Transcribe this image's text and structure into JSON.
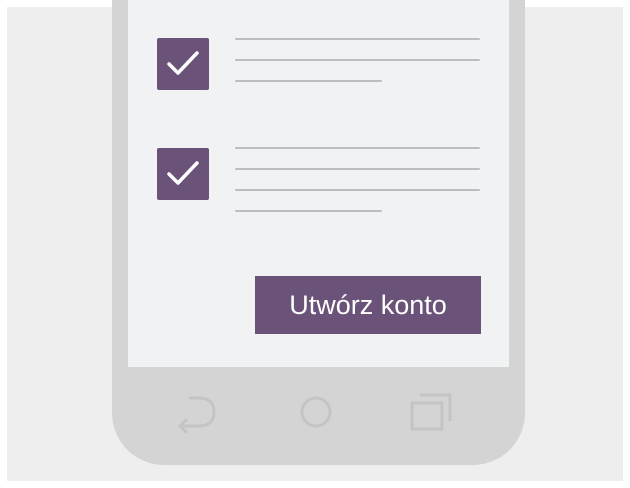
{
  "colors": {
    "accent": "#6a5279",
    "phone_body": "#d4d4d4",
    "screen_bg": "#f1f2f3",
    "background": "#eeeeee",
    "placeholder_line": "#bdbdbd",
    "nav_icon": "#c4c4c4"
  },
  "consent_items": [
    {
      "checked": true,
      "icon": "checkmark-icon",
      "text_line_count": 3
    },
    {
      "checked": true,
      "icon": "checkmark-icon",
      "text_line_count": 4
    }
  ],
  "create_account_button": {
    "label": "Utwórz konto"
  },
  "navigation_bar": {
    "icons": [
      "back-icon",
      "home-icon",
      "recents-icon"
    ]
  }
}
